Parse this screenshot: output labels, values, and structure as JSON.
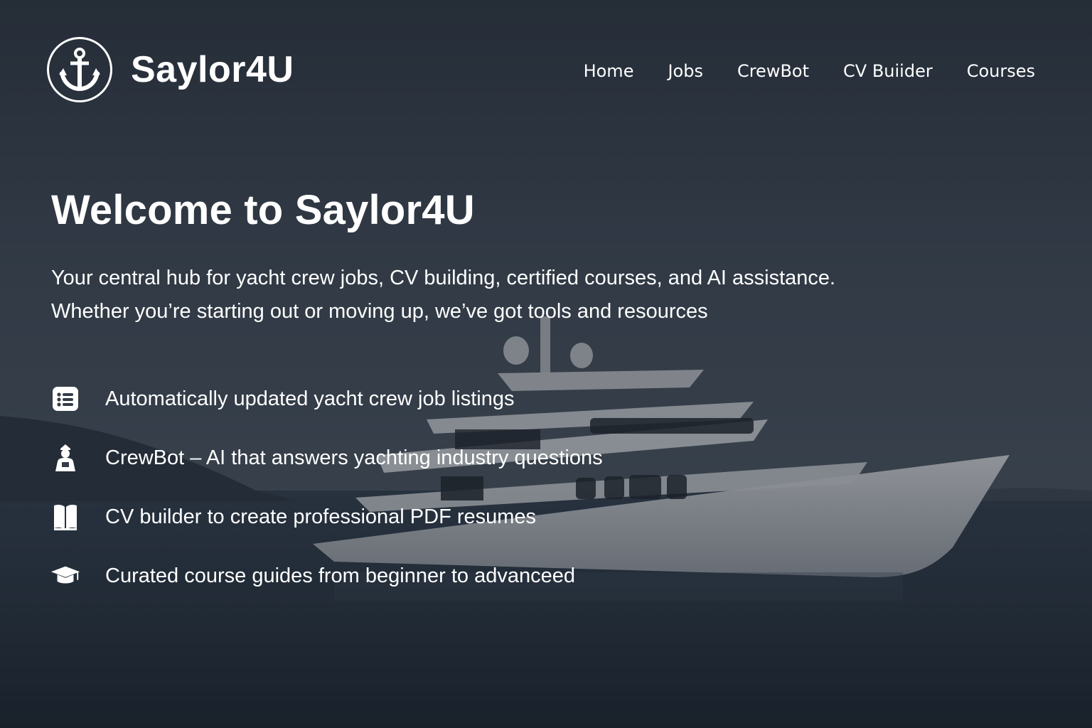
{
  "header": {
    "brand_name": "Saylor4U",
    "logo_icon": "anchor-icon",
    "nav": [
      {
        "label": "Home"
      },
      {
        "label": "Jobs"
      },
      {
        "label": "CrewBot"
      },
      {
        "label": "CV Buiider"
      },
      {
        "label": "Courses"
      }
    ]
  },
  "hero": {
    "title": "Welcome to Saylor4U",
    "intro_line_1": "Your central hub for yacht crew jobs, CV building, certified courses, and AI assistance.",
    "intro_line_2": "Whether you’re starting out or moving up, we’ve got tools and resources",
    "background": "superyacht-at-sea-photo"
  },
  "features": [
    {
      "icon": "list-icon",
      "text": "Automatically updated yacht crew job listings"
    },
    {
      "icon": "crew-person-icon",
      "text": "CrewBot – AI that answers yachting industry questions"
    },
    {
      "icon": "book-icon",
      "text": "CV builder to create professional PDF resumes"
    },
    {
      "icon": "graduation-cap-icon",
      "text": "Curated course guides from beginner to advanceed"
    }
  ],
  "colors": {
    "text": "#ffffff",
    "overlay": "#1f2833"
  }
}
